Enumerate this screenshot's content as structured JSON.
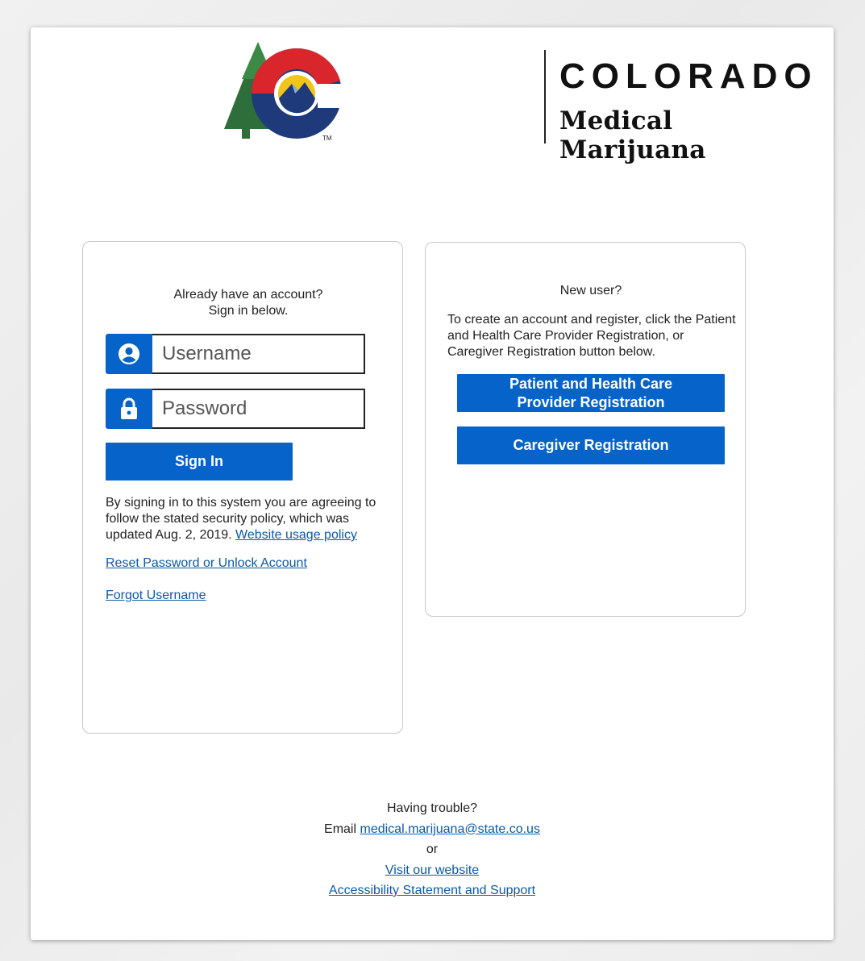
{
  "brand": {
    "name": "COLORADO",
    "subtitle": "Medical Marijuana",
    "trademark": "TM"
  },
  "signin": {
    "heading_line1": "Already have an account?",
    "heading_line2": "Sign in below.",
    "username_placeholder": "Username",
    "password_placeholder": "Password",
    "sign_in_label": "Sign In",
    "policy_text": "By signing in to this system you are agreeing to follow the stated security policy, which was updated Aug. 2, 2019.",
    "policy_link": "Website usage policy",
    "reset_link": "Reset Password or Unlock Account",
    "forgot_link": "Forgot Username"
  },
  "register": {
    "heading": "New user?",
    "description": "To create an account and register, click the Patient and Health Care Provider Registration, or Caregiver Registration button below.",
    "patient_button_line1": "Patient and Health Care",
    "patient_button_line2": "Provider Registration",
    "caregiver_button": "Caregiver Registration"
  },
  "footer": {
    "trouble": "Having trouble?",
    "email_prefix": "Email",
    "email": "medical.marijuana@state.co.us",
    "or": "or",
    "website_link": "Visit our website",
    "accessibility_link": "Accessibility Statement and Support"
  },
  "icons": {
    "username": "user-circle-icon",
    "password": "lock-icon"
  },
  "colors": {
    "primary": "#0563c9",
    "link": "#0b5aa8",
    "logo_red": "#d9262c",
    "logo_blue": "#1f3a7a",
    "logo_green": "#2e6e3a",
    "logo_yellow": "#f2c51b"
  }
}
